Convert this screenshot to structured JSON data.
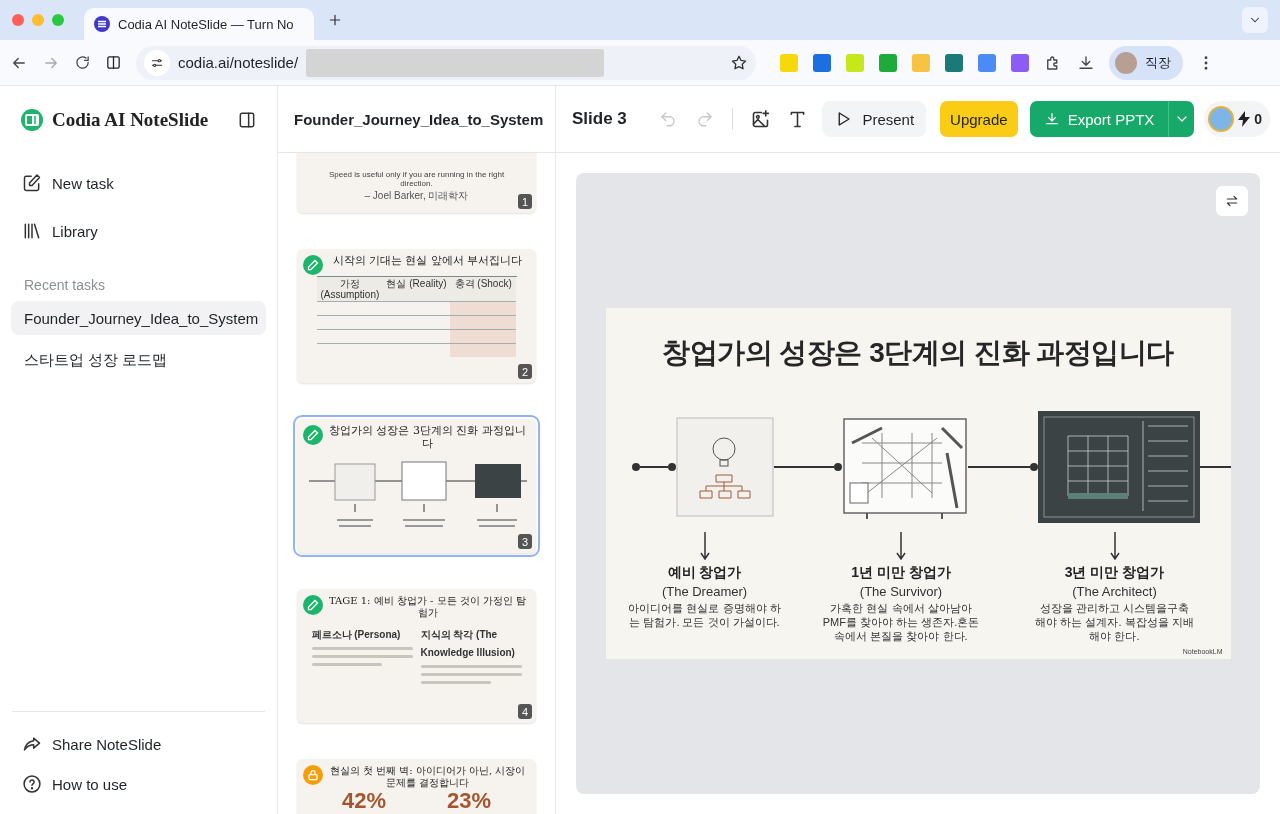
{
  "browser": {
    "tab_title": "Codia AI NoteSlide — Turn No",
    "url": "codia.ai/noteslide/",
    "profile": "직장"
  },
  "sidebar": {
    "brand": "Codia AI NoteSlide",
    "nav": [
      {
        "label": "New task",
        "kind": "new"
      },
      {
        "label": "Library",
        "kind": "library"
      }
    ],
    "recent_heading": "Recent tasks",
    "recent": [
      {
        "label": "Founder_Journey_Idea_to_System",
        "selected": true
      },
      {
        "label": "스타트업 성장 로드맵",
        "selected": false
      }
    ],
    "footer": [
      {
        "label": "Share NoteSlide",
        "kind": "share"
      },
      {
        "label": "How to use",
        "kind": "help"
      }
    ]
  },
  "slides_panel": {
    "title": "Founder_Journey_Idea_to_System",
    "slides": [
      {
        "number": "1",
        "kind": "quote",
        "editable": false,
        "locked": false,
        "selected": false,
        "quote": "Speed is useful only if you are running in the right direction.",
        "attribution": "– Joel Barker, 미래학자"
      },
      {
        "number": "2",
        "kind": "table",
        "editable": true,
        "locked": false,
        "selected": false,
        "title": "시작의 기대는 현실 앞에서 부서집니다",
        "columns": [
          "가정 (Assumption)",
          "현실 (Reality)",
          "충격 (Shock)"
        ]
      },
      {
        "number": "3",
        "kind": "diagram",
        "editable": true,
        "locked": false,
        "selected": true,
        "title": "창업가의 성장은 3단계의 진화 과정입니다"
      },
      {
        "number": "4",
        "kind": "columns",
        "editable": true,
        "locked": false,
        "selected": false,
        "title": "TAGE 1: 예비 창업가 - 모든 것이 가정인 탐험가",
        "headings": [
          "페르소나 (Persona)",
          "지식의 착각 (The Knowledge Illusion)"
        ]
      },
      {
        "kind": "stats",
        "editable": false,
        "locked": true,
        "selected": false,
        "title": "현실의 첫 번째 벽: 아이디어가 아닌, 시장이 문제를 결정합니다",
        "stats": [
          "42%",
          "23%"
        ]
      }
    ]
  },
  "editor": {
    "slide_label": "Slide 3",
    "tools": [
      {
        "kind": "undo",
        "disabled": true
      },
      {
        "kind": "redo",
        "disabled": true
      }
    ],
    "present": "Present",
    "upgrade": "Upgrade",
    "export": "Export PPTX",
    "credits": "0"
  },
  "slide": {
    "title": "창업가의 성장은 3단계의 진화 과정입니다",
    "stages": [
      {
        "kind": "napkin",
        "name": "예비 창업가",
        "subtitle": "(The Dreamer)",
        "description": "아이디어를 현실로 증명해야 하는 탐험가. 모든 것이 가설이다."
      },
      {
        "kind": "sketch",
        "name": "1년 미만 창업가",
        "subtitle": "(The Survivor)",
        "description": "가혹한 현실 속에서 살아남아 PMF를 찾아야 하는 생존자.혼돈 속에서 본질을 찾아야 한다."
      },
      {
        "kind": "blueprint",
        "name": "3년 미만 창업가",
        "subtitle": "(The Architect)",
        "description": "성장을 관리하고 시스템을구축해야 하는 설계자. 복잡성을 지배해야 한다."
      }
    ],
    "credit": "NotebookLM"
  }
}
